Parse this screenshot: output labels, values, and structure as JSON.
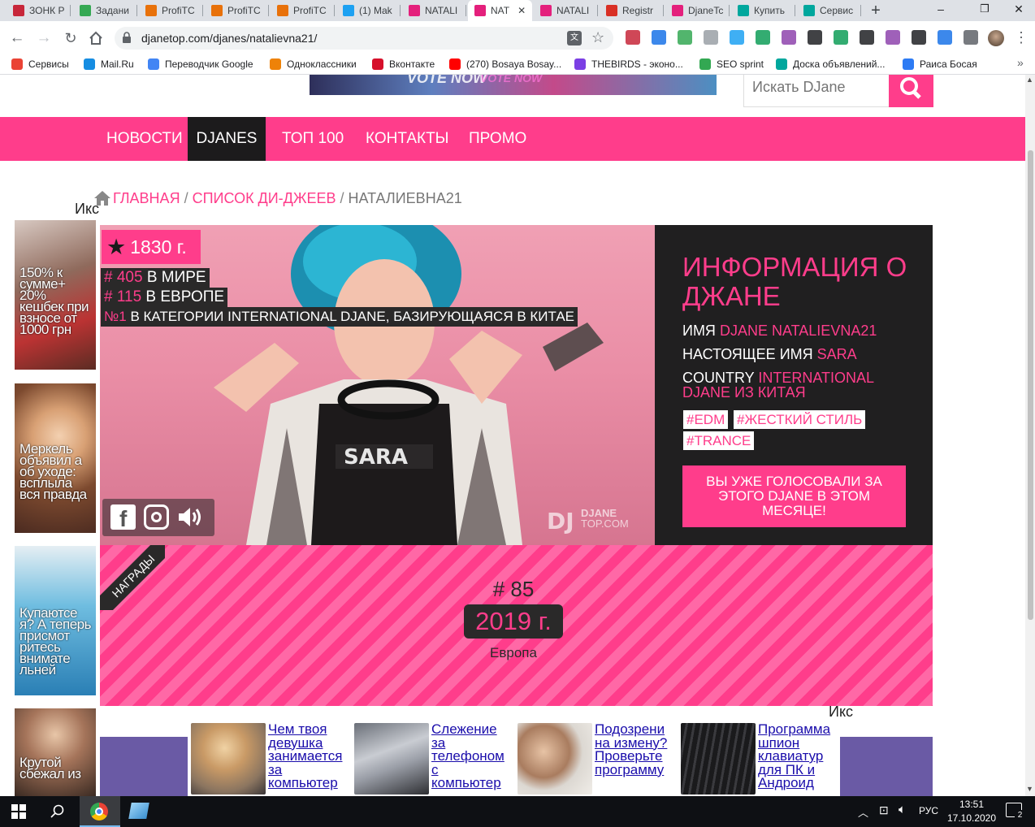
{
  "browser": {
    "tabs": [
      {
        "label": "ЗОНК Р",
        "color": "#c7273a"
      },
      {
        "label": "Задани",
        "color": "#35a853"
      },
      {
        "label": "ProfiTC",
        "color": "#e8710a"
      },
      {
        "label": "ProfiTC",
        "color": "#e8710a"
      },
      {
        "label": "ProfiTC",
        "color": "#e8710a"
      },
      {
        "label": "(1) Mak",
        "color": "#1da1f2"
      },
      {
        "label": "NATALI",
        "color": "#e4207c"
      },
      {
        "label": "NAT",
        "color": "#e4207c"
      },
      {
        "label": "NATALI",
        "color": "#e4207c"
      },
      {
        "label": "Registr",
        "color": "#d93025"
      },
      {
        "label": "DjaneTc",
        "color": "#e4207c"
      },
      {
        "label": "Купить",
        "color": "#00a79d"
      },
      {
        "label": "Сервис",
        "color": "#00a79d"
      }
    ],
    "new_tab": "+",
    "url": "djanetop.com/djanes/natalievna21/",
    "window_controls": [
      "–",
      "❐",
      "✕"
    ],
    "bookmarks": [
      {
        "label": "Сервисы",
        "color": "#ea4335"
      },
      {
        "label": "Mail.Ru",
        "color": "#168de2"
      },
      {
        "label": "Переводчик Google",
        "color": "#4285f4"
      },
      {
        "label": "Одноклассники",
        "color": "#ee8208"
      },
      {
        "label": "Вконтакте",
        "color": "#d6102b"
      },
      {
        "label": "(270) Bosaya Bosay...",
        "color": "#ff0000"
      },
      {
        "label": "THEBIRDS - эконо...",
        "color": "#7b3fe4"
      },
      {
        "label": "SEO sprint",
        "color": "#33a852"
      },
      {
        "label": "Доска объявлений...",
        "color": "#00a79d"
      },
      {
        "label": "Раиса Босая",
        "color": "#2d7bf4"
      }
    ],
    "more": "»"
  },
  "page": {
    "search_placeholder": "Искать DJane",
    "nav": [
      "НОВОСТИ",
      "DJANES",
      "ТОП 100",
      "КОНТАКТЫ",
      "ПРОМО"
    ],
    "breadcrumb": {
      "home": "ГЛАВНАЯ",
      "sep1": "/",
      "list": "СПИСОК ДИ-ДЖЕЕВ",
      "sep2": "/",
      "current": "НАТАЛИЕВНА21"
    },
    "close_label_left": "Икс",
    "close_label_bottom": "Икс",
    "profile": {
      "votes": "1830 г.",
      "world_prefix": "# 405",
      "world_text": "В МИРЕ",
      "europe_prefix": "# 115",
      "europe_text": "В ЕВРОПЕ",
      "category_prefix": "№1",
      "category_text": "В КАТЕГОРИИ INTERNATIONAL DJANE, БАЗИРУЮЩАЯСЯ В КИТАЕ",
      "watermark_dj": "DJ",
      "watermark_djane": "DJANE",
      "watermark_top": "TOP.COM"
    },
    "info": {
      "title": "ИНФОРМАЦИЯ О ДЖАНЕ",
      "name_label": "ИМЯ",
      "name_value": "DJANE NATALIEVNA21",
      "real_label": "НАСТОЯЩЕЕ ИМЯ",
      "real_value": "SARA",
      "country_label": "COUNTRY",
      "country_value": "INTERNATIONAL DJANE ИЗ КИТАЯ",
      "tags": [
        "#EDM",
        "#ЖЕСТКИЙ СТИЛЬ",
        "#TRANCE"
      ],
      "vote_button": "ВЫ УЖЕ ГОЛОСОВАЛИ ЗА ЭТОГО DJANE В ЭТОМ МЕСЯЦЕ!"
    },
    "awards": {
      "ribbon": "НАГРАДЫ",
      "rank": "# 85",
      "year": "2019 г.",
      "region": "Европа"
    },
    "side_ads": [
      {
        "text": "150% к сумме+ 20% кешбек при взносе от 1000 грн"
      },
      {
        "text": "Меркель объявил а об уходе: всплыла вся правда"
      },
      {
        "text": "Купаютсе я? А теперь присмот ритесь внимате льней"
      },
      {
        "text": "Крутой сбежал из"
      }
    ],
    "bottom_ads": [
      {
        "text": "Чем твоя девушка занимается за компьютер"
      },
      {
        "text": "Слежение за телефоном с компьютер"
      },
      {
        "text": "Подозрени на измену? Проверьте программу"
      },
      {
        "text": "Программа шпион клавиатур для ПК и Андроид"
      }
    ]
  },
  "taskbar": {
    "lang": "РУС",
    "time": "13:51",
    "date": "17.10.2020",
    "notif_count": "2"
  }
}
